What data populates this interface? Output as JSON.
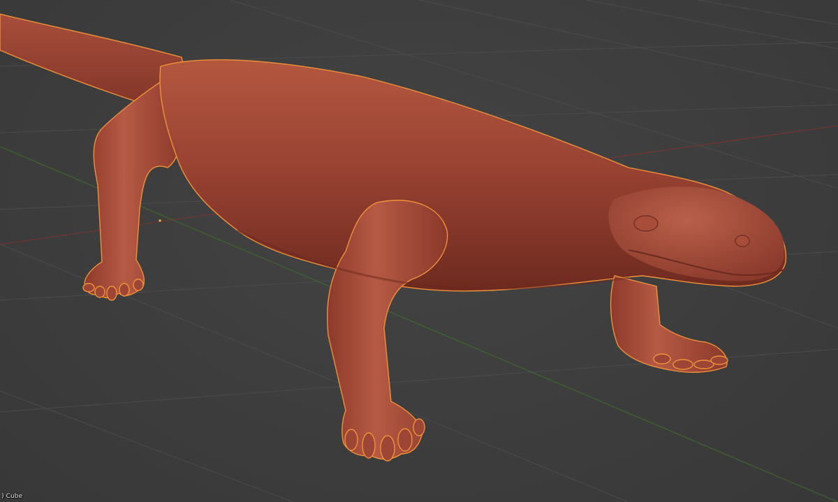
{
  "viewport": {
    "object_label": ") Cube",
    "background_color": "#3d3d3d",
    "grid_color": "#4b4b4b",
    "x_axis_color": "#7a3434",
    "y_axis_color": "#3e6e2a",
    "selection_outline_color": "#f0923a",
    "model_color": "#a44b38"
  }
}
